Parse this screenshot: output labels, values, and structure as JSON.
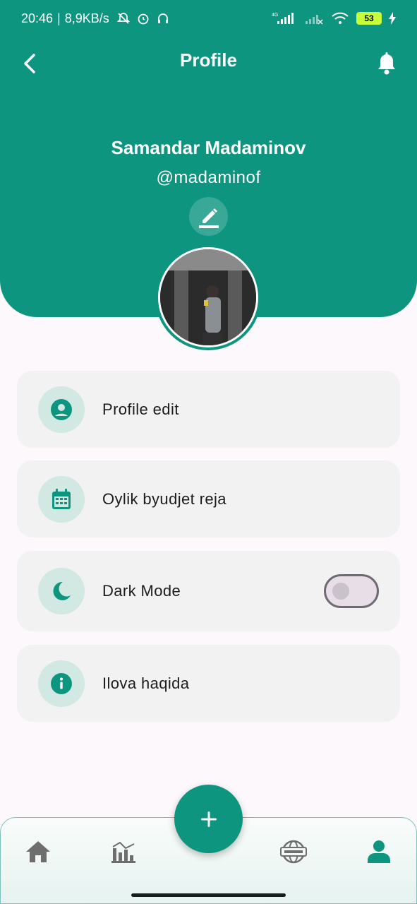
{
  "status_bar": {
    "time": "20:46",
    "net_speed": "8,9KB/s",
    "network": "4G",
    "battery": "53"
  },
  "header": {
    "title": "Profile"
  },
  "profile": {
    "name": "Samandar Madaminov",
    "handle": "@madaminof"
  },
  "menu": [
    {
      "label": "Profile edit",
      "icon": "account-circle-icon"
    },
    {
      "label": "Oylik byudjet reja",
      "icon": "calendar-icon"
    },
    {
      "label": "Dark Mode",
      "icon": "moon-icon",
      "toggle": false
    },
    {
      "label": "Ilova haqida",
      "icon": "info-icon"
    }
  ],
  "bottom_nav": {
    "items": [
      "home-icon",
      "stats-icon",
      "add-icon",
      "news-icon",
      "profile-icon"
    ],
    "active": "profile-icon"
  },
  "colors": {
    "primary": "#0E9580",
    "card_bg": "#F2F2F2",
    "icon_bg": "#D1E8E3",
    "page_bg": "#FCF8FC"
  }
}
